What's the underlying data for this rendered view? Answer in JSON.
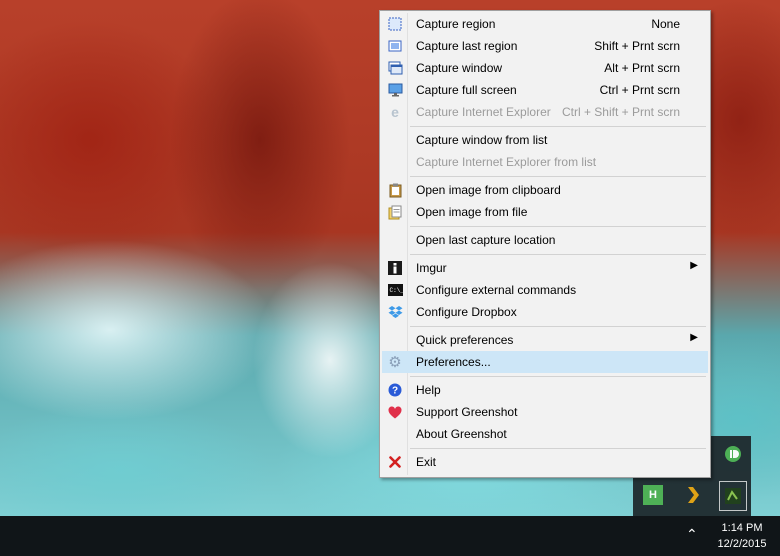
{
  "menu": {
    "items": [
      {
        "label": "Capture region",
        "shortcut": "None",
        "icon": "capture-region-icon"
      },
      {
        "label": "Capture last region",
        "shortcut": "Shift + Prnt scrn",
        "icon": "capture-last-region-icon"
      },
      {
        "label": "Capture window",
        "shortcut": "Alt + Prnt scrn",
        "icon": "capture-window-icon"
      },
      {
        "label": "Capture full screen",
        "shortcut": "Ctrl + Prnt scrn",
        "icon": "capture-full-screen-icon"
      },
      {
        "label": "Capture Internet Explorer",
        "shortcut": "Ctrl + Shift + Prnt scrn",
        "icon": "internet-explorer-icon",
        "disabled": true
      },
      {
        "label": "Capture window from list"
      },
      {
        "label": "Capture Internet Explorer from list",
        "disabled": true
      },
      {
        "label": "Open image from clipboard",
        "icon": "clipboard-icon"
      },
      {
        "label": "Open image from file",
        "icon": "folder-file-icon"
      },
      {
        "label": "Open last capture location"
      },
      {
        "label": "Imgur",
        "icon": "imgur-icon",
        "submenu": true
      },
      {
        "label": "Configure external commands",
        "icon": "command-prompt-icon"
      },
      {
        "label": "Configure Dropbox",
        "icon": "dropbox-icon"
      },
      {
        "label": "Quick preferences",
        "submenu": true
      },
      {
        "label": "Preferences...",
        "icon": "gear-icon",
        "highlighted": true
      },
      {
        "label": "Help",
        "icon": "help-icon"
      },
      {
        "label": "Support Greenshot",
        "icon": "heart-icon"
      },
      {
        "label": "About Greenshot"
      },
      {
        "label": "Exit",
        "icon": "close-icon"
      }
    ]
  },
  "tray": {
    "icons": [
      "pushbullet-icon",
      "h-app-icon",
      "plex-icon",
      "greenshot-icon"
    ]
  },
  "taskbar": {
    "time": "1:14 PM",
    "date": "12/2/2015"
  },
  "colors": {
    "highlight": "#cde6f7",
    "menu_bg": "#f2f2f2",
    "taskbar": "#101518",
    "disabled_text": "#9b9b9b"
  }
}
